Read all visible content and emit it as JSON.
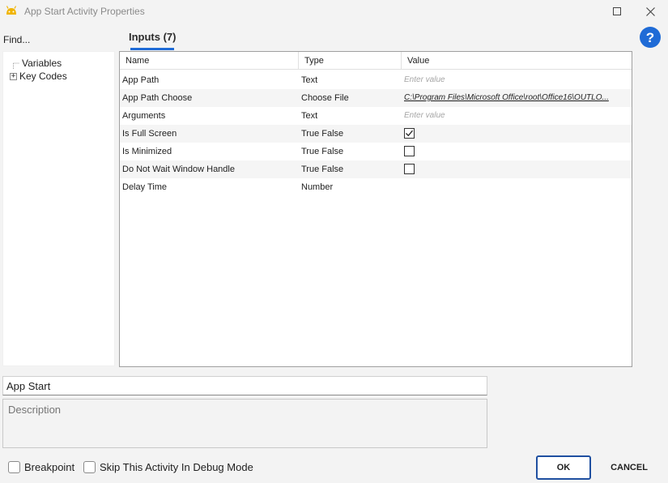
{
  "window": {
    "title": "App Start Activity Properties",
    "icon": "android-robot-icon",
    "accent": "#1f6bd6"
  },
  "sidebar": {
    "find_label": "Find...",
    "tree": [
      {
        "label": "Variables",
        "expandable": false
      },
      {
        "label": "Key Codes",
        "expandable": true
      }
    ]
  },
  "tabs": [
    {
      "label": "Inputs (7)",
      "selected": true
    }
  ],
  "grid": {
    "columns": [
      "Name",
      "Type",
      "Value"
    ],
    "rows": [
      {
        "name": "App Path",
        "type": "Text",
        "value": "",
        "placeholder": "Enter value"
      },
      {
        "name": "App Path Choose",
        "type": "Choose File",
        "value": "C:\\Program Files\\Microsoft Office\\root\\Office16\\OUTLO..."
      },
      {
        "name": "Arguments",
        "type": "Text",
        "value": "",
        "placeholder": "Enter value"
      },
      {
        "name": "Is Full Screen",
        "type": "True False",
        "checked": true
      },
      {
        "name": "Is Minimized",
        "type": "True False",
        "checked": false
      },
      {
        "name": "Do Not Wait Window Handle",
        "type": "True False",
        "checked": false
      },
      {
        "name": "Delay Time",
        "type": "Number",
        "value": ""
      }
    ]
  },
  "activity_name": "App Start",
  "description_placeholder": "Description",
  "footer": {
    "breakpoint_label": "Breakpoint",
    "skip_label": "Skip This Activity In Debug Mode",
    "ok_label": "OK",
    "cancel_label": "CANCEL"
  }
}
